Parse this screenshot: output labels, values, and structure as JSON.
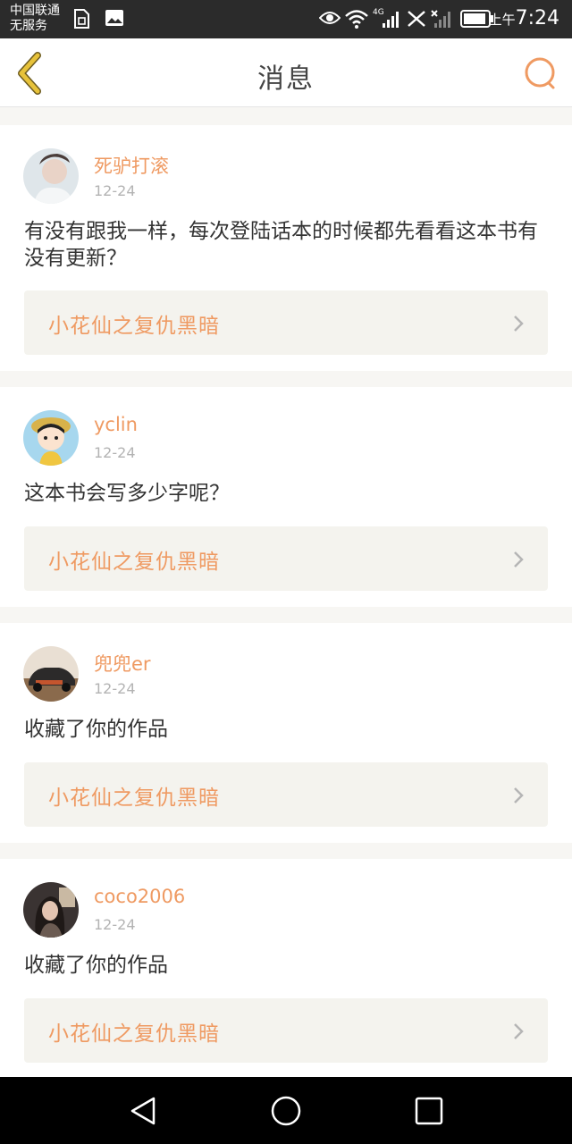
{
  "status_bar": {
    "carrier_line1": "中国联通",
    "carrier_line2": "无服务",
    "time_prefix": "上午",
    "time": "7:24",
    "network": "4G",
    "icons": [
      "sim-card-icon",
      "image-icon",
      "eye-icon",
      "wifi-icon",
      "signal-icon",
      "no-signal-icon",
      "battery-icon"
    ]
  },
  "header": {
    "title": "消息",
    "back_icon": "chevron-left-icon",
    "search_icon": "search-icon"
  },
  "colors": {
    "accent": "#ef9a62",
    "back_icon": "#e7c23a",
    "status_bar": "#2b2b2b",
    "book_bg": "#f4f3ee",
    "page_bg": "#f7f6f3"
  },
  "messages": [
    {
      "username": "死驴打滚",
      "date": "12-24",
      "text": "有没有跟我一样，每次登陆话本的时候都先看看这本书有没有更新？",
      "book": "小花仙之复仇黑暗"
    },
    {
      "username": "yclin",
      "date": "12-24",
      "text": "这本书会写多少字呢？",
      "book": "小花仙之复仇黑暗"
    },
    {
      "username": "兜兜er",
      "date": "12-24",
      "text": "收藏了你的作品",
      "book": "小花仙之复仇黑暗"
    },
    {
      "username": "coco2006",
      "date": "12-24",
      "text": "收藏了你的作品",
      "book": "小花仙之复仇黑暗"
    }
  ],
  "nav": {
    "back_icon": "triangle-back-icon",
    "home_icon": "circle-home-icon",
    "recents_icon": "square-recents-icon"
  }
}
